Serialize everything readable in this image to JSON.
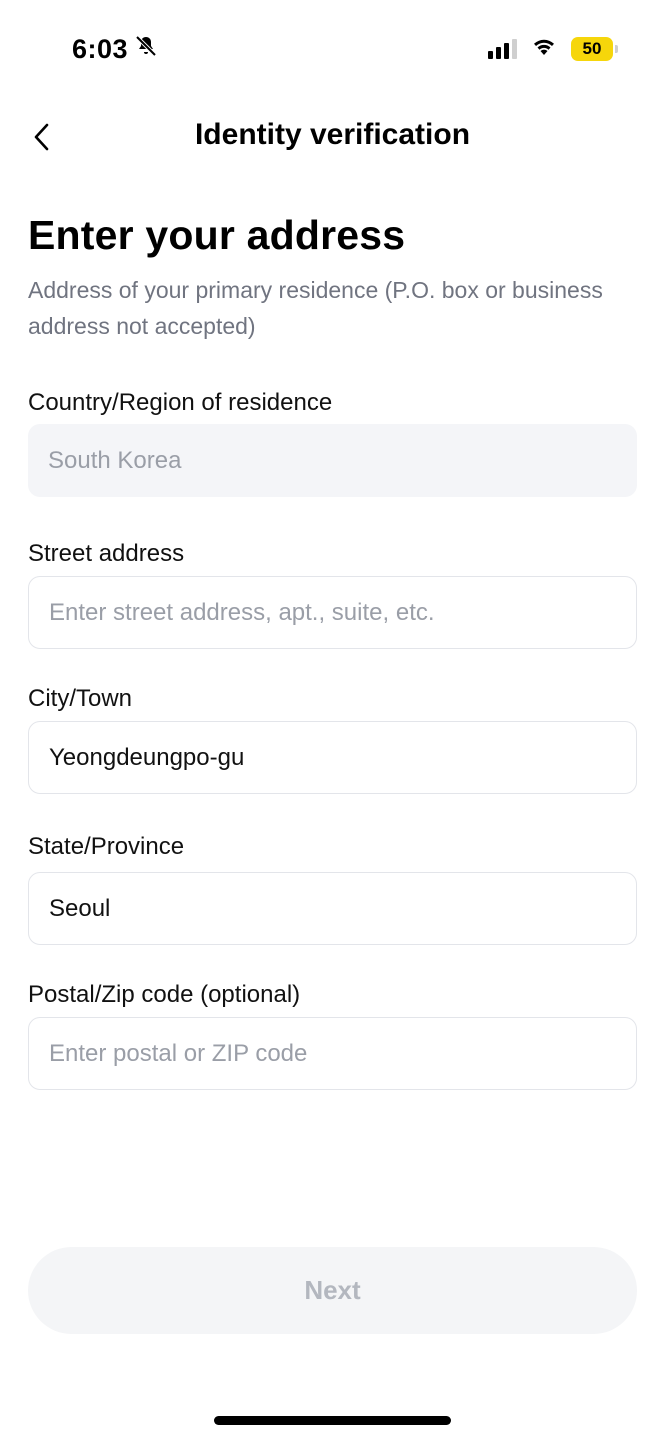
{
  "status_bar": {
    "time": "6:03",
    "battery": "50",
    "icons": [
      "bell-slash-icon",
      "signal-icon",
      "wifi-icon",
      "battery-icon"
    ]
  },
  "nav": {
    "back_icon": "chevron-left-icon",
    "title": "Identity verification"
  },
  "heading": "Enter your address",
  "subtitle": "Address of your primary residence (P.O. box or business address not accepted)",
  "fields": {
    "country": {
      "label": "Country/Region of residence",
      "value": "South Korea"
    },
    "street": {
      "label": "Street address",
      "placeholder": "Enter street address, apt., suite, etc.",
      "value": ""
    },
    "city": {
      "label": "City/Town",
      "value": "Yeongdeungpo-gu"
    },
    "state": {
      "label": "State/Province",
      "value": "Seoul"
    },
    "postal": {
      "label": "Postal/Zip code (optional)",
      "placeholder": "Enter postal or ZIP code",
      "value": ""
    }
  },
  "next_label": "Next",
  "colors": {
    "battery": "#f6d60b",
    "placeholder": "#9a9ea7",
    "disabled_field_bg": "#f4f5f8",
    "button_bg": "#f4f5f7",
    "button_text_disabled": "#b3b7bf"
  }
}
